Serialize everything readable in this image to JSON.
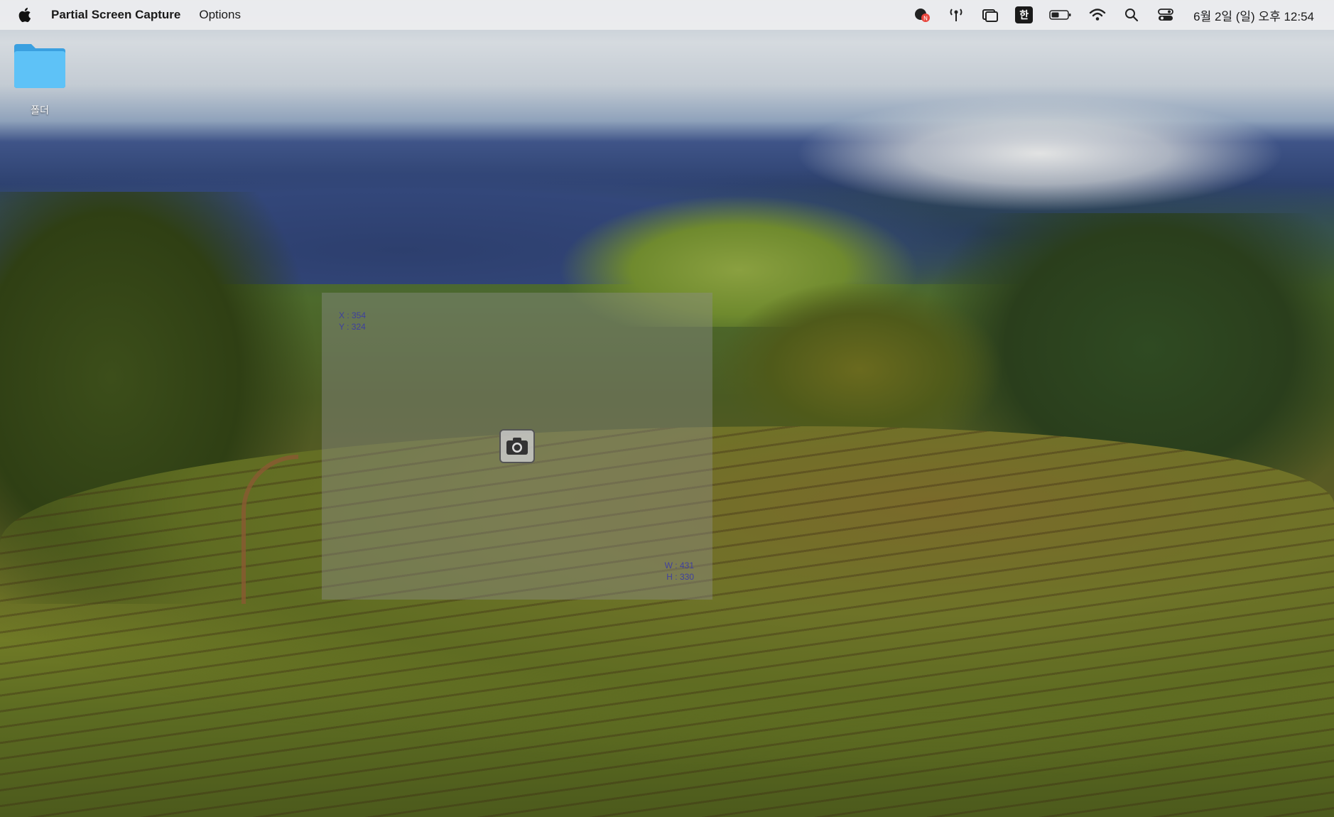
{
  "menubar": {
    "app_name": "Partial Screen Capture",
    "menus": [
      "Options"
    ],
    "ime_label": "한",
    "clock": "6월 2일 (일) 오후 12:54",
    "status_icons": [
      "notification-icon",
      "antenna-icon",
      "window-stack-icon",
      "input-method-icon",
      "battery-icon",
      "wifi-icon",
      "search-icon",
      "control-center-icon"
    ]
  },
  "desktop": {
    "folder_label": "폴더"
  },
  "selection": {
    "origin_x_label": "X : 354",
    "origin_y_label": "Y : 324",
    "width_label": "W : 431",
    "height_label": "H : 330",
    "capture_icon": "camera-icon"
  },
  "colors": {
    "menubar_bg": "#eeeef0",
    "folder_blue": "#4ab3f0",
    "selection_tint": "#8c8c8c",
    "coord_text": "#3a3aa8"
  }
}
